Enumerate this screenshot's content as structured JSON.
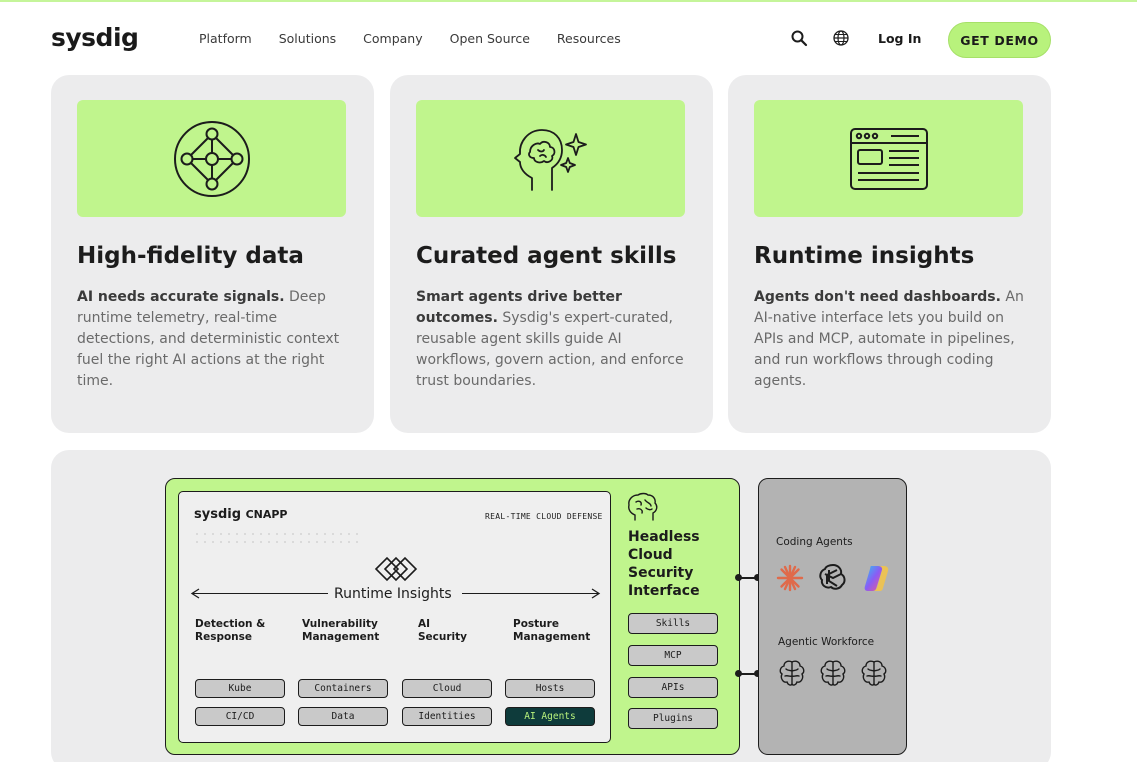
{
  "nav": {
    "logo": "sysdig",
    "links": [
      "Platform",
      "Solutions",
      "Company",
      "Open Source",
      "Resources"
    ],
    "search_icon": "search-icon",
    "language_icon": "globe-icon",
    "login_label": "Log In",
    "demo_label": "GET DEMO"
  },
  "colors": {
    "accent_green": "#c0f58d",
    "card_bg": "#ececed",
    "text_dark": "#1c1c1c",
    "pill_dark": "#0e3b3b"
  },
  "cards": [
    {
      "icon": "network-nodes-icon",
      "title": "High-fidelity data",
      "lead": "AI needs accurate signals.",
      "text": " Deep runtime telemetry, real-time detections, and deterministic context fuel the right AI actions at the right time."
    },
    {
      "icon": "brain-sparkle-icon",
      "title": "Curated agent skills",
      "lead": "Smart agents drive better outcomes.",
      "text": " Sysdig's expert-curated, reusable agent skills guide AI workflows, govern action, and enforce trust boundaries."
    },
    {
      "icon": "browser-window-icon",
      "title": "Runtime insights",
      "lead": "Agents don't need dashboards.",
      "text": " An AI-native interface lets you build on APIs and MCP, automate in pipelines, and run workflows through coding agents."
    }
  ],
  "diagram": {
    "cnapp_brand": "sysdig",
    "cnapp_product": "CNAPP",
    "tagline": "REAL-TIME CLOUD DEFENSE",
    "runtime_label": "Runtime Insights",
    "columns": [
      {
        "label": "Detection & Response",
        "pills": [
          "Kube",
          "CI/CD"
        ]
      },
      {
        "label": "Vulnerability Management",
        "pills": [
          "Containers",
          "Data"
        ]
      },
      {
        "label": "AI Security",
        "pills": [
          "Cloud",
          "Identities"
        ]
      },
      {
        "label": "Posture Management",
        "pills": [
          "Hosts",
          "AI Agents"
        ]
      }
    ],
    "headless_title": "Headless Cloud Security Interface",
    "headless_items": [
      "Skills",
      "MCP",
      "APIs",
      "Plugins"
    ],
    "coding_agents_label": "Coding Agents",
    "coding_agent_icons": [
      "claude-icon",
      "openai-icon",
      "copilot-icon"
    ],
    "workforce_label": "Agentic Workforce",
    "workforce_icons": [
      "brain-icon",
      "brain-icon",
      "brain-icon"
    ]
  }
}
